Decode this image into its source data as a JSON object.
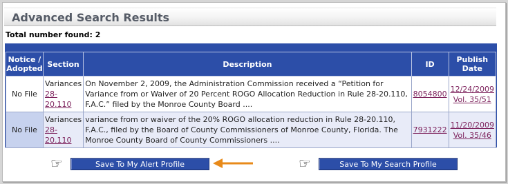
{
  "title": "Advanced Search Results",
  "total_label": "Total number found: 2",
  "columns": {
    "notice": "Notice / Adopted",
    "section": "Section",
    "description": "Description",
    "id": "ID",
    "publish": "Publish Date"
  },
  "rows": [
    {
      "notice": "No File",
      "section_name": "Variances",
      "section_link": "28-20.110",
      "description": "On November 2, 2009, the Administration Commission received a “Petition for Variance from or Waiver of 20 Percent ROGO Allocation Reduction in Rule 28-20.110, F.A.C.” filed by the Monroe County Board ....",
      "id": "8054800",
      "date": "12/24/2009",
      "volume": "Vol. 35/51"
    },
    {
      "notice": "No File",
      "section_name": "Variances",
      "section_link": "28-20.110",
      "description": "variance from or waiver of the 20% ROGO allocation reduction in Rule 28-20.110, F.A.C., filed by the Board of County Commissioners of Monroe County, Florida. The Monroe County Board of County Commissioners ....",
      "id": "7931222",
      "date": "11/20/2009",
      "volume": "Vol. 35/46"
    }
  ],
  "buttons": {
    "alert": "Save To My Alert Profile",
    "search": "Save To My Search Profile"
  },
  "icons": {
    "hand": "pointing-hand-icon",
    "arrow": "orange-arrow-icon"
  },
  "colors": {
    "header_blue": "#2c4ea8",
    "link": "#7b1f5a",
    "arrow": "#e88a1a"
  }
}
